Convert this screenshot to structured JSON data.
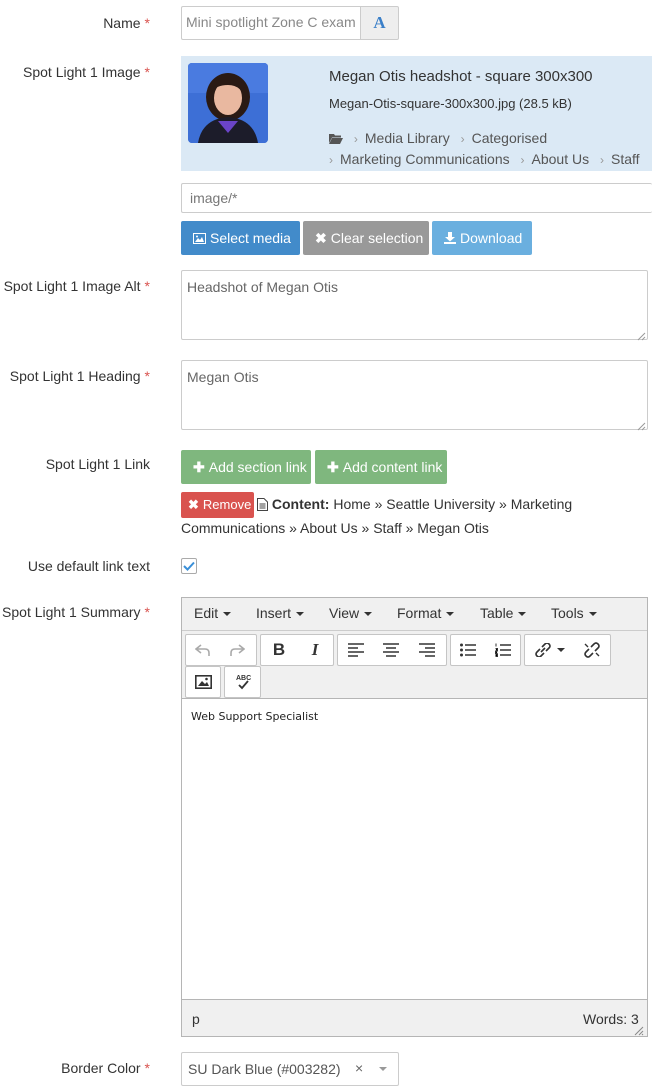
{
  "fields": {
    "name": {
      "label": "Name",
      "value": "Mini spotlight Zone C exam"
    },
    "image": {
      "label": "Spot Light 1 Image",
      "title": "Megan Otis headshot - square 300x300",
      "filename": "Megan-Otis-square-300x300.jpg (28.5 kB)",
      "path": [
        "Media Library",
        "Categorised",
        "Marketing Communications",
        "About Us",
        "Staff"
      ],
      "filter": "image/*",
      "buttons": {
        "select": "Select media",
        "clear": "Clear selection",
        "download": "Download"
      }
    },
    "image_alt": {
      "label": "Spot Light 1 Image Alt",
      "value": "Headshot of Megan Otis"
    },
    "heading": {
      "label": "Spot Light 1 Heading",
      "value": "Megan Otis"
    },
    "link": {
      "label": "Spot Light 1 Link",
      "add_section": "Add section link",
      "add_content": "Add content link",
      "remove": "Remove",
      "content_label": "Content:",
      "content_path_line1": "Home » Seattle University » Marketing",
      "content_path_line2": "Communications » About Us » Staff » Megan Otis"
    },
    "default_link_text": {
      "label": "Use default link text",
      "checked": true
    },
    "summary": {
      "label": "Spot Light 1 Summary",
      "menus": [
        "Edit",
        "Insert",
        "View",
        "Format",
        "Table",
        "Tools"
      ],
      "body": "Web Support Specialist",
      "status_path": "p",
      "word_count": "Words: 3"
    },
    "border_color": {
      "label": "Border Color",
      "value": "SU Dark Blue (#003282)",
      "clear_glyph": "×"
    }
  },
  "colors": {
    "required": "#d9534f",
    "btn_primary": "#428bca",
    "btn_default": "#999999",
    "btn_info": "#5bc0de",
    "btn_success": "#7fb77e",
    "btn_danger": "#d9534f",
    "media_panel": "#dbe9f5",
    "checkbox": "#3a8fd8"
  },
  "icons": [
    "font-icon",
    "folder-icon",
    "image-icon",
    "times-icon",
    "download-icon",
    "plus-icon",
    "file-icon",
    "check-icon",
    "undo-icon",
    "redo-icon",
    "bold-icon",
    "italic-icon",
    "align-left-icon",
    "align-center-icon",
    "align-right-icon",
    "bullet-list-icon",
    "numbered-list-icon",
    "link-icon",
    "unlink-icon",
    "insert-image-icon",
    "spellcheck-icon",
    "resize-handle-icon"
  ]
}
